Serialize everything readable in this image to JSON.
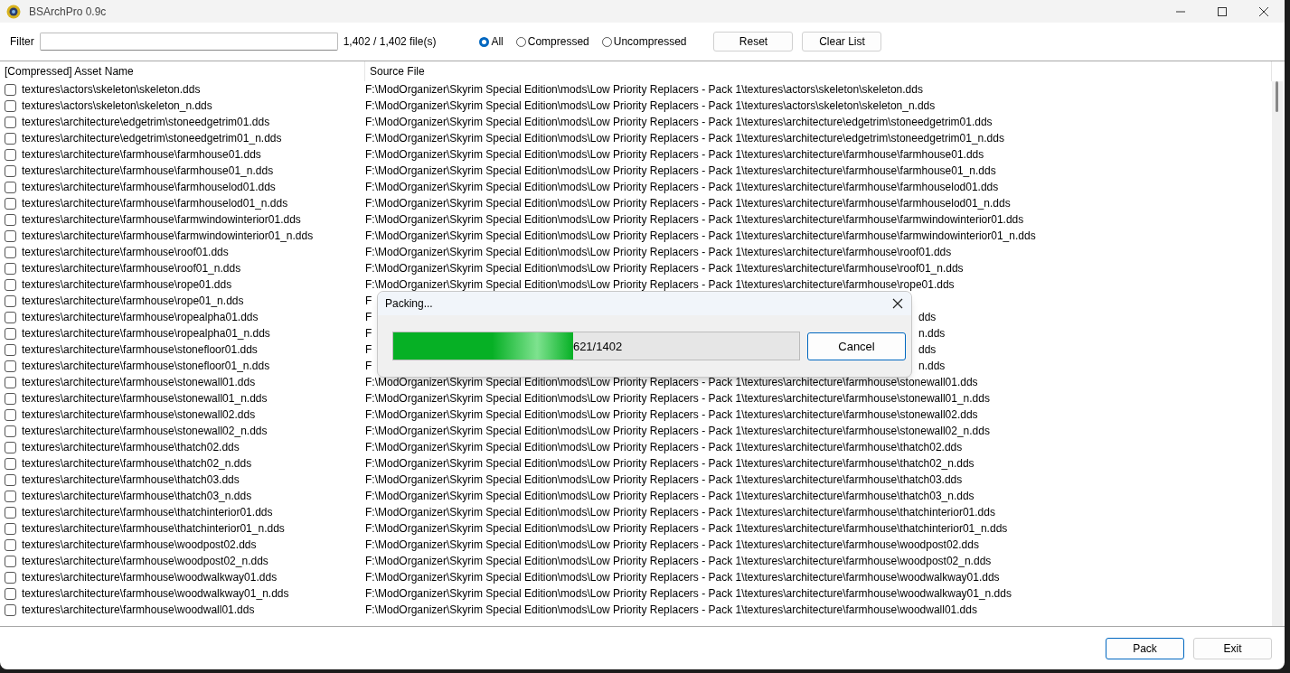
{
  "window": {
    "title": "BSArchPro 0.9c"
  },
  "filter": {
    "label": "Filter",
    "count": "1,402 / 1,402 file(s)"
  },
  "filter_modes": [
    {
      "label": "All",
      "selected": true
    },
    {
      "label": "Compressed",
      "selected": false
    },
    {
      "label": "Uncompressed",
      "selected": false
    }
  ],
  "toolbar_buttons": [
    "Reset",
    "Clear List"
  ],
  "table": {
    "columns": [
      "[Compressed] Asset Name",
      "Source File"
    ],
    "rows": [
      {
        "checked": false,
        "asset": "textures\\actors\\skeleton\\skeleton.dds",
        "source": "F:\\ModOrganizer\\Skyrim Special Edition\\mods\\Low Priority Replacers - Pack 1\\textures\\actors\\skeleton\\skeleton.dds"
      },
      {
        "checked": false,
        "asset": "textures\\actors\\skeleton\\skeleton_n.dds",
        "source": "F:\\ModOrganizer\\Skyrim Special Edition\\mods\\Low Priority Replacers - Pack 1\\textures\\actors\\skeleton\\skeleton_n.dds"
      },
      {
        "checked": false,
        "asset": "textures\\architecture\\edgetrim\\stoneedgetrim01.dds",
        "source": "F:\\ModOrganizer\\Skyrim Special Edition\\mods\\Low Priority Replacers - Pack 1\\textures\\architecture\\edgetrim\\stoneedgetrim01.dds"
      },
      {
        "checked": false,
        "asset": "textures\\architecture\\edgetrim\\stoneedgetrim01_n.dds",
        "source": "F:\\ModOrganizer\\Skyrim Special Edition\\mods\\Low Priority Replacers - Pack 1\\textures\\architecture\\edgetrim\\stoneedgetrim01_n.dds"
      },
      {
        "checked": false,
        "asset": "textures\\architecture\\farmhouse\\farmhouse01.dds",
        "source": "F:\\ModOrganizer\\Skyrim Special Edition\\mods\\Low Priority Replacers - Pack 1\\textures\\architecture\\farmhouse\\farmhouse01.dds"
      },
      {
        "checked": false,
        "asset": "textures\\architecture\\farmhouse\\farmhouse01_n.dds",
        "source": "F:\\ModOrganizer\\Skyrim Special Edition\\mods\\Low Priority Replacers - Pack 1\\textures\\architecture\\farmhouse\\farmhouse01_n.dds"
      },
      {
        "checked": false,
        "asset": "textures\\architecture\\farmhouse\\farmhouselod01.dds",
        "source": "F:\\ModOrganizer\\Skyrim Special Edition\\mods\\Low Priority Replacers - Pack 1\\textures\\architecture\\farmhouse\\farmhouselod01.dds"
      },
      {
        "checked": false,
        "asset": "textures\\architecture\\farmhouse\\farmhouselod01_n.dds",
        "source": "F:\\ModOrganizer\\Skyrim Special Edition\\mods\\Low Priority Replacers - Pack 1\\textures\\architecture\\farmhouse\\farmhouselod01_n.dds"
      },
      {
        "checked": false,
        "asset": "textures\\architecture\\farmhouse\\farmwindowinterior01.dds",
        "source": "F:\\ModOrganizer\\Skyrim Special Edition\\mods\\Low Priority Replacers - Pack 1\\textures\\architecture\\farmhouse\\farmwindowinterior01.dds"
      },
      {
        "checked": false,
        "asset": "textures\\architecture\\farmhouse\\farmwindowinterior01_n.dds",
        "source": "F:\\ModOrganizer\\Skyrim Special Edition\\mods\\Low Priority Replacers - Pack 1\\textures\\architecture\\farmhouse\\farmwindowinterior01_n.dds"
      },
      {
        "checked": false,
        "asset": "textures\\architecture\\farmhouse\\roof01.dds",
        "source": "F:\\ModOrganizer\\Skyrim Special Edition\\mods\\Low Priority Replacers - Pack 1\\textures\\architecture\\farmhouse\\roof01.dds"
      },
      {
        "checked": false,
        "asset": "textures\\architecture\\farmhouse\\roof01_n.dds",
        "source": "F:\\ModOrganizer\\Skyrim Special Edition\\mods\\Low Priority Replacers - Pack 1\\textures\\architecture\\farmhouse\\roof01_n.dds"
      },
      {
        "checked": false,
        "asset": "textures\\architecture\\farmhouse\\rope01.dds",
        "source": "F:\\ModOrganizer\\Skyrim Special Edition\\mods\\Low Priority Replacers - Pack 1\\textures\\architecture\\farmhouse\\rope01.dds"
      },
      {
        "checked": false,
        "asset": "textures\\architecture\\farmhouse\\rope01_n.dds",
        "source": "F"
      },
      {
        "checked": false,
        "asset": "textures\\architecture\\farmhouse\\ropealpha01.dds",
        "source": "F",
        "source_end": "dds"
      },
      {
        "checked": false,
        "asset": "textures\\architecture\\farmhouse\\ropealpha01_n.dds",
        "source": "F",
        "source_end": "n.dds"
      },
      {
        "checked": false,
        "asset": "textures\\architecture\\farmhouse\\stonefloor01.dds",
        "source": "F",
        "source_end": "dds"
      },
      {
        "checked": false,
        "asset": "textures\\architecture\\farmhouse\\stonefloor01_n.dds",
        "source": "F",
        "source_end": "n.dds"
      },
      {
        "checked": false,
        "asset": "textures\\architecture\\farmhouse\\stonewall01.dds",
        "source": "F:\\ModOrganizer\\Skyrim Special Edition\\mods\\Low Priority Replacers - Pack 1\\textures\\architecture\\farmhouse\\stonewall01.dds"
      },
      {
        "checked": false,
        "asset": "textures\\architecture\\farmhouse\\stonewall01_n.dds",
        "source": "F:\\ModOrganizer\\Skyrim Special Edition\\mods\\Low Priority Replacers - Pack 1\\textures\\architecture\\farmhouse\\stonewall01_n.dds"
      },
      {
        "checked": false,
        "asset": "textures\\architecture\\farmhouse\\stonewall02.dds",
        "source": "F:\\ModOrganizer\\Skyrim Special Edition\\mods\\Low Priority Replacers - Pack 1\\textures\\architecture\\farmhouse\\stonewall02.dds"
      },
      {
        "checked": false,
        "asset": "textures\\architecture\\farmhouse\\stonewall02_n.dds",
        "source": "F:\\ModOrganizer\\Skyrim Special Edition\\mods\\Low Priority Replacers - Pack 1\\textures\\architecture\\farmhouse\\stonewall02_n.dds"
      },
      {
        "checked": false,
        "asset": "textures\\architecture\\farmhouse\\thatch02.dds",
        "source": "F:\\ModOrganizer\\Skyrim Special Edition\\mods\\Low Priority Replacers - Pack 1\\textures\\architecture\\farmhouse\\thatch02.dds"
      },
      {
        "checked": false,
        "asset": "textures\\architecture\\farmhouse\\thatch02_n.dds",
        "source": "F:\\ModOrganizer\\Skyrim Special Edition\\mods\\Low Priority Replacers - Pack 1\\textures\\architecture\\farmhouse\\thatch02_n.dds"
      },
      {
        "checked": false,
        "asset": "textures\\architecture\\farmhouse\\thatch03.dds",
        "source": "F:\\ModOrganizer\\Skyrim Special Edition\\mods\\Low Priority Replacers - Pack 1\\textures\\architecture\\farmhouse\\thatch03.dds"
      },
      {
        "checked": false,
        "asset": "textures\\architecture\\farmhouse\\thatch03_n.dds",
        "source": "F:\\ModOrganizer\\Skyrim Special Edition\\mods\\Low Priority Replacers - Pack 1\\textures\\architecture\\farmhouse\\thatch03_n.dds"
      },
      {
        "checked": false,
        "asset": "textures\\architecture\\farmhouse\\thatchinterior01.dds",
        "source": "F:\\ModOrganizer\\Skyrim Special Edition\\mods\\Low Priority Replacers - Pack 1\\textures\\architecture\\farmhouse\\thatchinterior01.dds"
      },
      {
        "checked": false,
        "asset": "textures\\architecture\\farmhouse\\thatchinterior01_n.dds",
        "source": "F:\\ModOrganizer\\Skyrim Special Edition\\mods\\Low Priority Replacers - Pack 1\\textures\\architecture\\farmhouse\\thatchinterior01_n.dds"
      },
      {
        "checked": false,
        "asset": "textures\\architecture\\farmhouse\\woodpost02.dds",
        "source": "F:\\ModOrganizer\\Skyrim Special Edition\\mods\\Low Priority Replacers - Pack 1\\textures\\architecture\\farmhouse\\woodpost02.dds"
      },
      {
        "checked": false,
        "asset": "textures\\architecture\\farmhouse\\woodpost02_n.dds",
        "source": "F:\\ModOrganizer\\Skyrim Special Edition\\mods\\Low Priority Replacers - Pack 1\\textures\\architecture\\farmhouse\\woodpost02_n.dds"
      },
      {
        "checked": false,
        "asset": "textures\\architecture\\farmhouse\\woodwalkway01.dds",
        "source": "F:\\ModOrganizer\\Skyrim Special Edition\\mods\\Low Priority Replacers - Pack 1\\textures\\architecture\\farmhouse\\woodwalkway01.dds"
      },
      {
        "checked": false,
        "asset": "textures\\architecture\\farmhouse\\woodwalkway01_n.dds",
        "source": "F:\\ModOrganizer\\Skyrim Special Edition\\mods\\Low Priority Replacers - Pack 1\\textures\\architecture\\farmhouse\\woodwalkway01_n.dds"
      },
      {
        "checked": false,
        "asset": "textures\\architecture\\farmhouse\\woodwall01.dds",
        "source": "F:\\ModOrganizer\\Skyrim Special Edition\\mods\\Low Priority Replacers - Pack 1\\textures\\architecture\\farmhouse\\woodwall01.dds"
      }
    ]
  },
  "progress_dialog": {
    "title": "Packing...",
    "level": 0.443,
    "reading": "621/1402",
    "button": "Cancel"
  },
  "footer_buttons": [
    {
      "label": "Pack",
      "default": true
    },
    {
      "label": "Exit",
      "default": false
    }
  ]
}
